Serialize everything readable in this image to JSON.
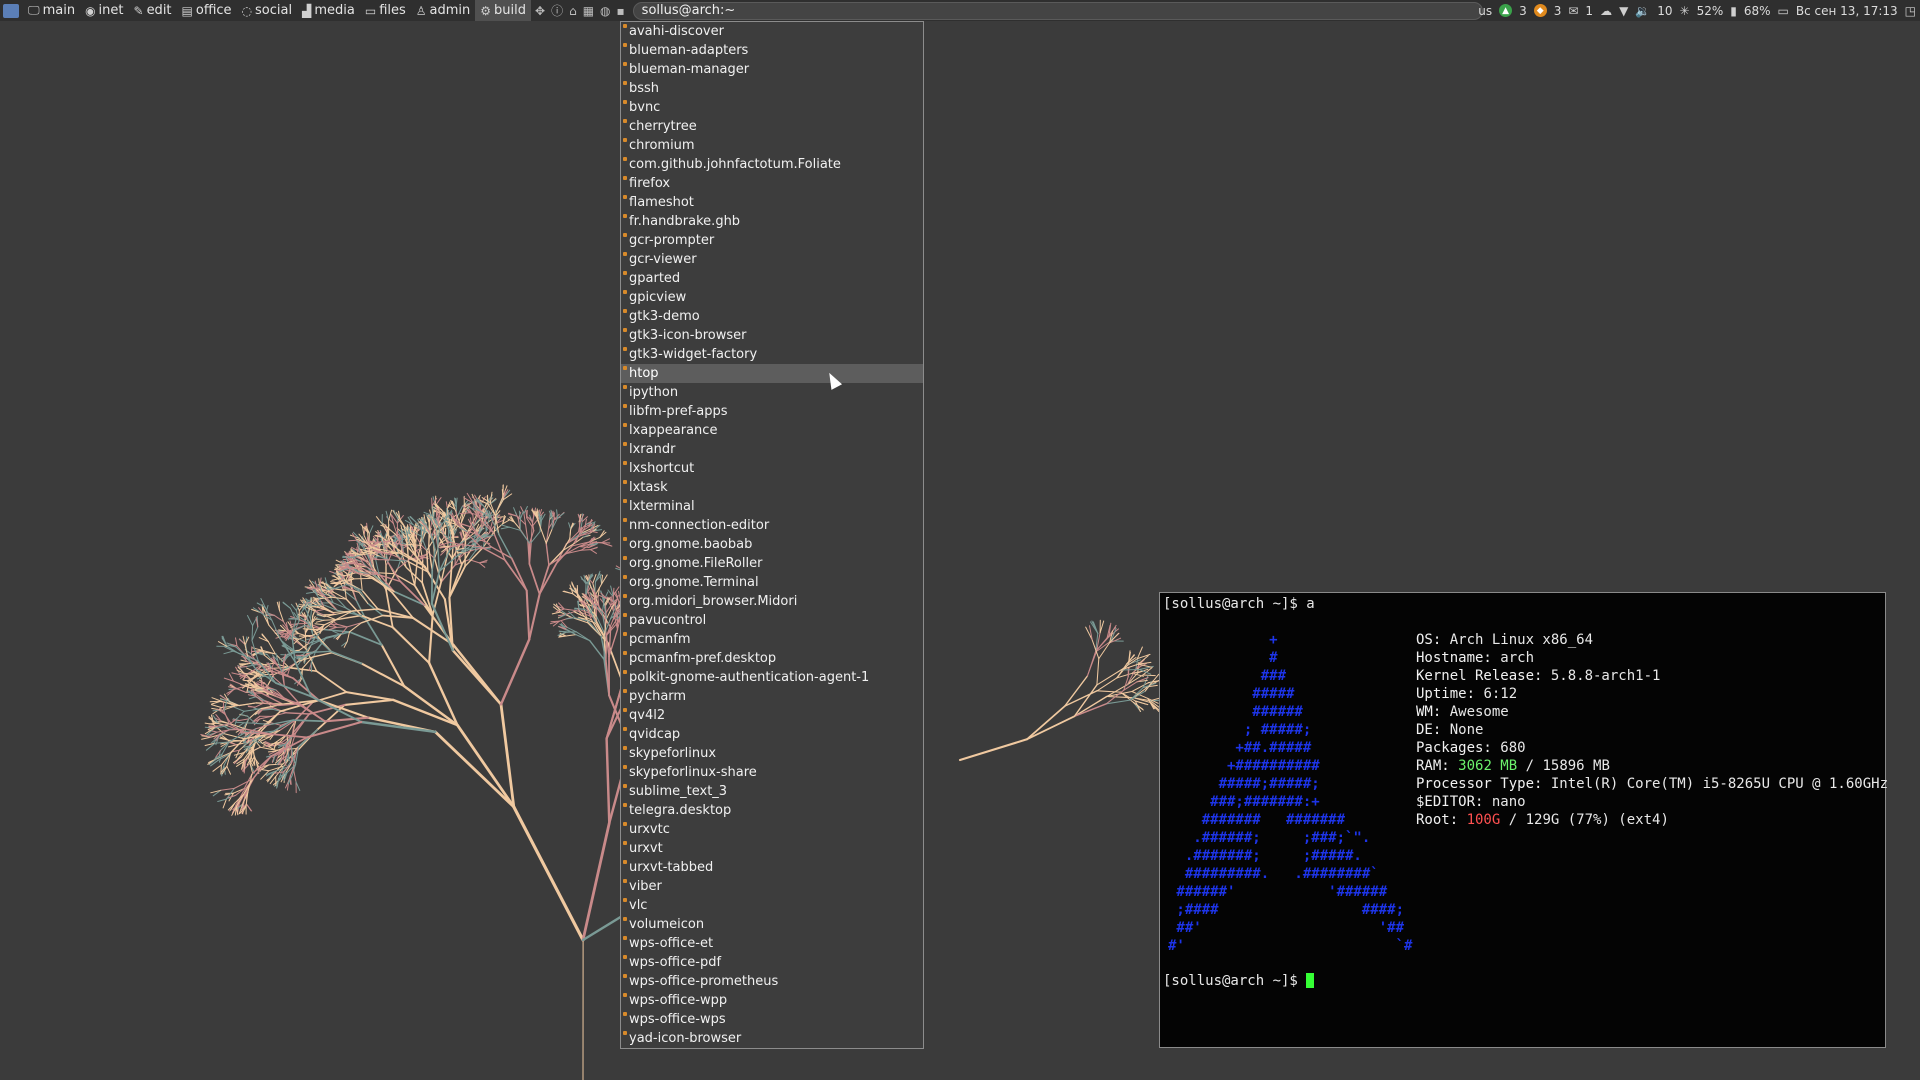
{
  "topbar": {
    "tags": [
      {
        "icon": "monitor-icon",
        "glyph": "🖵",
        "label": "main"
      },
      {
        "icon": "globe-icon",
        "glyph": "◉",
        "label": "inet"
      },
      {
        "icon": "edit-icon",
        "glyph": "✎",
        "label": "edit"
      },
      {
        "icon": "document-icon",
        "glyph": "▤",
        "label": "office"
      },
      {
        "icon": "chat-icon",
        "glyph": "◌",
        "label": "social"
      },
      {
        "icon": "chart-icon",
        "glyph": "▟",
        "label": "media"
      },
      {
        "icon": "folder-icon",
        "glyph": "▭",
        "label": "files"
      },
      {
        "icon": "user-icon",
        "glyph": "♙",
        "label": "admin"
      },
      {
        "icon": "gears-icon",
        "glyph": "⚙",
        "label": "build"
      }
    ],
    "active_tag": "build",
    "task_title": "sollus@arch:~",
    "right": {
      "keyboard_layout": "us",
      "badge1": "3",
      "badge2": "3",
      "mail_count": "1",
      "volume": "10",
      "brightness": "52%",
      "battery": "68%",
      "clock": "Вс сен 13, 17:13"
    }
  },
  "app_menu": {
    "items": [
      "avahi-discover",
      "blueman-adapters",
      "blueman-manager",
      "bssh",
      "bvnc",
      "cherrytree",
      "chromium",
      "com.github.johnfactotum.Foliate",
      "firefox",
      "flameshot",
      "fr.handbrake.ghb",
      "gcr-prompter",
      "gcr-viewer",
      "gparted",
      "gpicview",
      "gtk3-demo",
      "gtk3-icon-browser",
      "gtk3-widget-factory",
      "htop",
      "ipython",
      "libfm-pref-apps",
      "lxappearance",
      "lxrandr",
      "lxshortcut",
      "lxtask",
      "lxterminal",
      "nm-connection-editor",
      "org.gnome.baobab",
      "org.gnome.FileRoller",
      "org.gnome.Terminal",
      "org.midori_browser.Midori",
      "pavucontrol",
      "pcmanfm",
      "pcmanfm-pref.desktop",
      "polkit-gnome-authentication-agent-1",
      "pycharm",
      "qv4l2",
      "qvidcap",
      "skypeforlinux",
      "skypeforlinux-share",
      "sublime_text_3",
      "telegra.desktop",
      "urxvtc",
      "urxvt",
      "urxvt-tabbed",
      "viber",
      "vlc",
      "volumeicon",
      "wps-office-et",
      "wps-office-pdf",
      "wps-office-prometheus",
      "wps-office-wpp",
      "wps-office-wps",
      "yad-icon-browser"
    ],
    "selected": "htop"
  },
  "terminal": {
    "prompt1": "[sollus@arch ~]$ a",
    "logo_lines": [
      "            +",
      "            #",
      "           ###",
      "          #####",
      "          ######",
      "         ; #####;",
      "        +##.#####",
      "       +##########",
      "      #####;#####;",
      "     ###;#######:+",
      "    #######   #######",
      "   .######;     ;###;`\".",
      "  .#######;     ;#####.",
      "  #########.   .########`",
      " ######'           '######",
      " ;####                 ####;",
      " ##'                     '##",
      "#'                         `#"
    ],
    "info": [
      {
        "key": "OS: ",
        "value": "Arch Linux x86_64",
        "color": ""
      },
      {
        "key": "Hostname: ",
        "value": "arch",
        "color": ""
      },
      {
        "key": "Kernel Release: ",
        "value": "5.8.8-arch1-1",
        "color": ""
      },
      {
        "key": "Uptime: ",
        "value": "6:12",
        "color": ""
      },
      {
        "key": "WM: ",
        "value": "Awesome",
        "color": ""
      },
      {
        "key": "DE: ",
        "value": "None",
        "color": ""
      },
      {
        "key": "Packages: ",
        "value": "680",
        "color": ""
      },
      {
        "key": "RAM: ",
        "value": "3062 MB",
        "color": "green",
        "rest": " / 15896 MB"
      },
      {
        "key": "Processor Type: ",
        "value": "Intel(R) Core(TM) i5-8265U CPU @ 1.60GHz",
        "color": ""
      },
      {
        "key": "$EDITOR: ",
        "value": "nano",
        "color": ""
      },
      {
        "key": "Root: ",
        "value": "100G",
        "color": "red",
        "rest": " / 129G (77%) (ext4)"
      }
    ],
    "prompt2": "[sollus@arch ~]$ "
  },
  "colors": {
    "desktop_bg": "#3b3b3b",
    "menu_marker": "#d88a2a",
    "logo_blue": "#1d34e8",
    "ram_green": "#6cf26c",
    "root_red": "#ff5050",
    "branch_teal": "#7a9a95",
    "branch_peach": "#f0c9a0",
    "branch_pink": "#c98a8a"
  }
}
